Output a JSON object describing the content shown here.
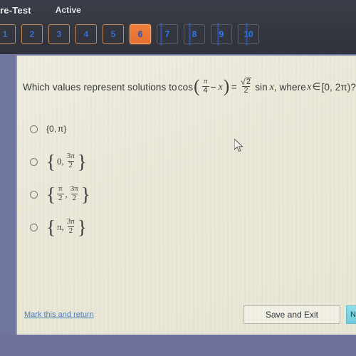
{
  "header": {
    "title": "re-Test",
    "status": "Active",
    "tabs": [
      {
        "label": "1",
        "state": "done"
      },
      {
        "label": "2",
        "state": "done"
      },
      {
        "label": "3",
        "state": "done"
      },
      {
        "label": "4",
        "state": "done"
      },
      {
        "label": "5",
        "state": "done"
      },
      {
        "label": "6",
        "state": "active"
      },
      {
        "label": "7",
        "state": "upcoming"
      },
      {
        "label": "8",
        "state": "upcoming"
      },
      {
        "label": "9",
        "state": "upcoming"
      },
      {
        "label": "10",
        "state": "upcoming"
      }
    ]
  },
  "question": {
    "lead": "Which values represent solutions to",
    "fn_cos": "cos",
    "arg_num": "π",
    "arg_den": "4",
    "arg_minus": "−",
    "arg_var": "x",
    "equals": "=",
    "radical_sign": "√",
    "radical_body": "2",
    "rad_den": "2",
    "fn_sin": "sin",
    "sin_var": "x",
    "tail": ", where",
    "domain_var": "x",
    "member": "∈",
    "domain": "[0, 2π)?"
  },
  "options": [
    {
      "id": "option-a",
      "open": "{",
      "first": "0",
      "comma": ",",
      "second_plain": "π",
      "close": "}",
      "type": "plain"
    },
    {
      "id": "option-b",
      "open": "{",
      "first": "0",
      "comma": ",",
      "frac_num": "3π",
      "frac_den": "2",
      "close": "}",
      "type": "frac-second"
    },
    {
      "id": "option-c",
      "open": "{",
      "f1_num": "π",
      "f1_den": "2",
      "comma": ",",
      "f2_num": "3π",
      "f2_den": "2",
      "close": "}",
      "type": "frac-both"
    },
    {
      "id": "option-d",
      "open": "{",
      "first": "π",
      "comma": ",",
      "frac_num": "3π",
      "frac_den": "2",
      "close": "}",
      "type": "frac-second"
    }
  ],
  "footer": {
    "mark_link": "Mark this and return",
    "save_exit": "Save and Exit",
    "next": "Ne"
  },
  "colors": {
    "header_bg": "#393b46",
    "panel_bg": "#eceadb",
    "active_tab": "#e8763a",
    "tab_number": "#3d6fd0",
    "link": "#4a7fb5",
    "next_button": "#7ed8e4",
    "outer_bg": "#6d719b"
  }
}
